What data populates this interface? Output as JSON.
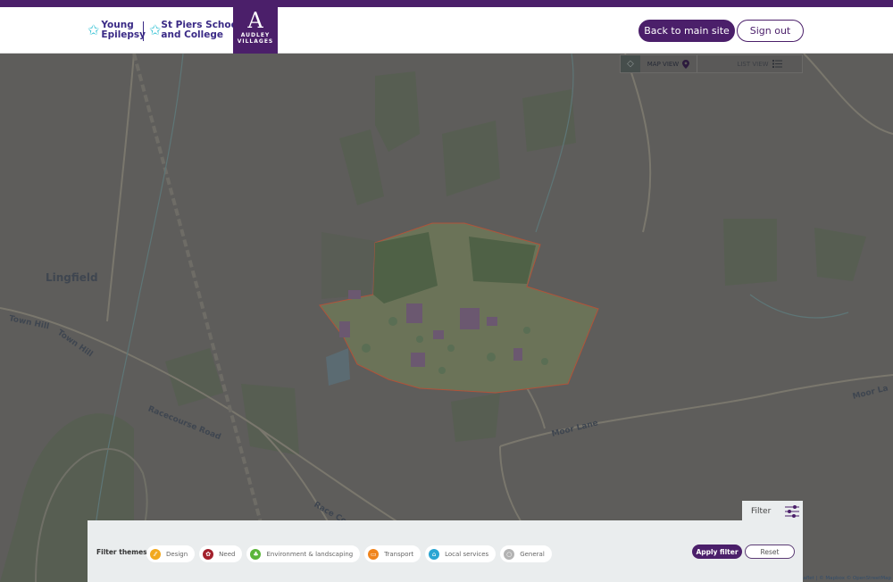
{
  "header": {
    "logos": {
      "young_epilepsy": [
        "Young",
        "Epilepsy"
      ],
      "st_piers": [
        "St Piers School",
        "and College"
      ],
      "audley_letter": "A",
      "audley_words": [
        "AUDLEY",
        "VILLAGES"
      ]
    },
    "back_button": "Back to main site",
    "signout_button": "Sign out"
  },
  "view_toggle": {
    "map_view": "MAP VIEW",
    "list_view": "LIST VIEW",
    "active": "map"
  },
  "map": {
    "labels": {
      "town": "Lingfield",
      "town_hill_1": "Town Hill",
      "town_hill_2": "Town Hill",
      "racecourse_road": "Racecourse Road",
      "race_course_2": "Race Co",
      "moor_lane_1": "Moor Lane",
      "moor_lane_2": "Moor La"
    },
    "attribution": "Leaflet | © Mapbox © OpenStreetMap",
    "colors": {
      "site_boundary": "#b0533a",
      "overlay": "#5e5d5b"
    }
  },
  "filter": {
    "tab_label": "Filter",
    "themes_label": "Filter themes",
    "themes": [
      {
        "label": "Design",
        "icon": "design-icon",
        "color": "#f2a91e"
      },
      {
        "label": "Need",
        "icon": "need-icon",
        "color": "#a3202c"
      },
      {
        "label": "Environment & landscaping",
        "icon": "environment-icon",
        "color": "#5bb53a"
      },
      {
        "label": "Transport",
        "icon": "transport-icon",
        "color": "#f0841c"
      },
      {
        "label": "Local services",
        "icon": "local-services-icon",
        "color": "#2aa5d3"
      },
      {
        "label": "General",
        "icon": "general-icon",
        "color": "#b3b3b3"
      }
    ],
    "apply_button": "Apply filter",
    "reset_button": "Reset"
  },
  "colors": {
    "brand_purple": "#4b1f6a",
    "logo_blue": "#3a2a86",
    "logo_star": "#3cc4d6",
    "panel_bg": "#eaedee"
  }
}
